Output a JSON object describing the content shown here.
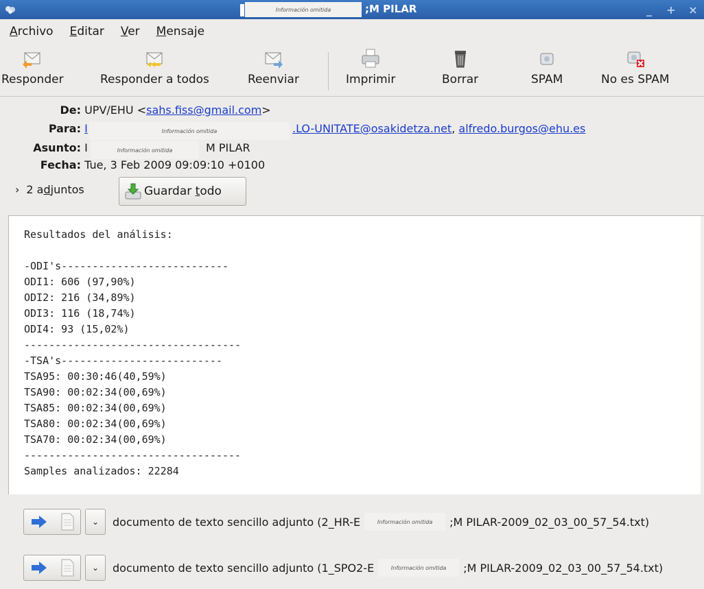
{
  "window": {
    "redaction": "Información omitida",
    "title_suffix": ";M PILAR",
    "controls": [
      "_",
      "+",
      "×"
    ]
  },
  "menubar": {
    "items": [
      {
        "key": "A",
        "rest": "rchivo"
      },
      {
        "key": "E",
        "rest": "ditar"
      },
      {
        "key": "V",
        "rest": "er"
      },
      {
        "key": "M",
        "rest": "ensaje"
      }
    ]
  },
  "toolbar": {
    "reply": "Responder",
    "reply_all": "Responder a todos",
    "forward": "Reenviar",
    "print": "Imprimir",
    "delete": "Borrar",
    "spam": "SPAM",
    "not_spam": "No es SPAM"
  },
  "headers": {
    "from_label": "De:",
    "from_name": "UPV/EHU <",
    "from_email": "sahs.fiss@gmail.com",
    "from_close": ">",
    "to_label": "Para:",
    "to_prefix": "I",
    "to_rest": ".LO-UNITATE@osakidetza.net",
    "to_sep": ", ",
    "to_second": "alfredo.burgos@ehu.es",
    "subject_label": "Asunto:",
    "subject_prefix": "I",
    "subject_suffix": "M PILAR",
    "date_label": "Fecha:",
    "date_value": "Tue, 3 Feb 2009 09:09:10 +0100",
    "redaction": "Información omitida"
  },
  "attachments_bar": {
    "toggle": "›",
    "count_pre": "2 a",
    "count_key": "d",
    "count_post": "juntos",
    "save_pre": "Guardar ",
    "save_key": "t",
    "save_post": "odo"
  },
  "body": {
    "lines": [
      "Resultados del análisis:",
      "",
      "-ODI's---------------------------",
      "ODI1: 606 (97,90%)",
      "ODI2: 216 (34,89%)",
      "ODI3: 116 (18,74%)",
      "ODI4: 93 (15,02%)",
      "-----------------------------------",
      "-TSA's--------------------------",
      "TSA95: 00:30:46(40,59%)",
      "TSA90: 00:02:34(00,69%)",
      "TSA85: 00:02:34(00,69%)",
      "TSA80: 00:02:34(00,69%)",
      "TSA70: 00:02:34(00,69%)",
      "-----------------------------------",
      "Samples analizados: 22284"
    ]
  },
  "attachments": [
    {
      "prefix": "documento de texto sencillo adjunto (2_HR-E",
      "redaction": "Información omitida",
      "suffix": ";M PILAR-2009_02_03_00_57_54.txt)"
    },
    {
      "prefix": "documento de texto sencillo adjunto (1_SPO2-E",
      "redaction": "Información omitida",
      "suffix": ";M PILAR-2009_02_03_00_57_54.txt)"
    }
  ],
  "colors": {
    "titlebar": "#2f69b5",
    "link": "#1a3cc9",
    "arrow": "#2f6fd6"
  }
}
